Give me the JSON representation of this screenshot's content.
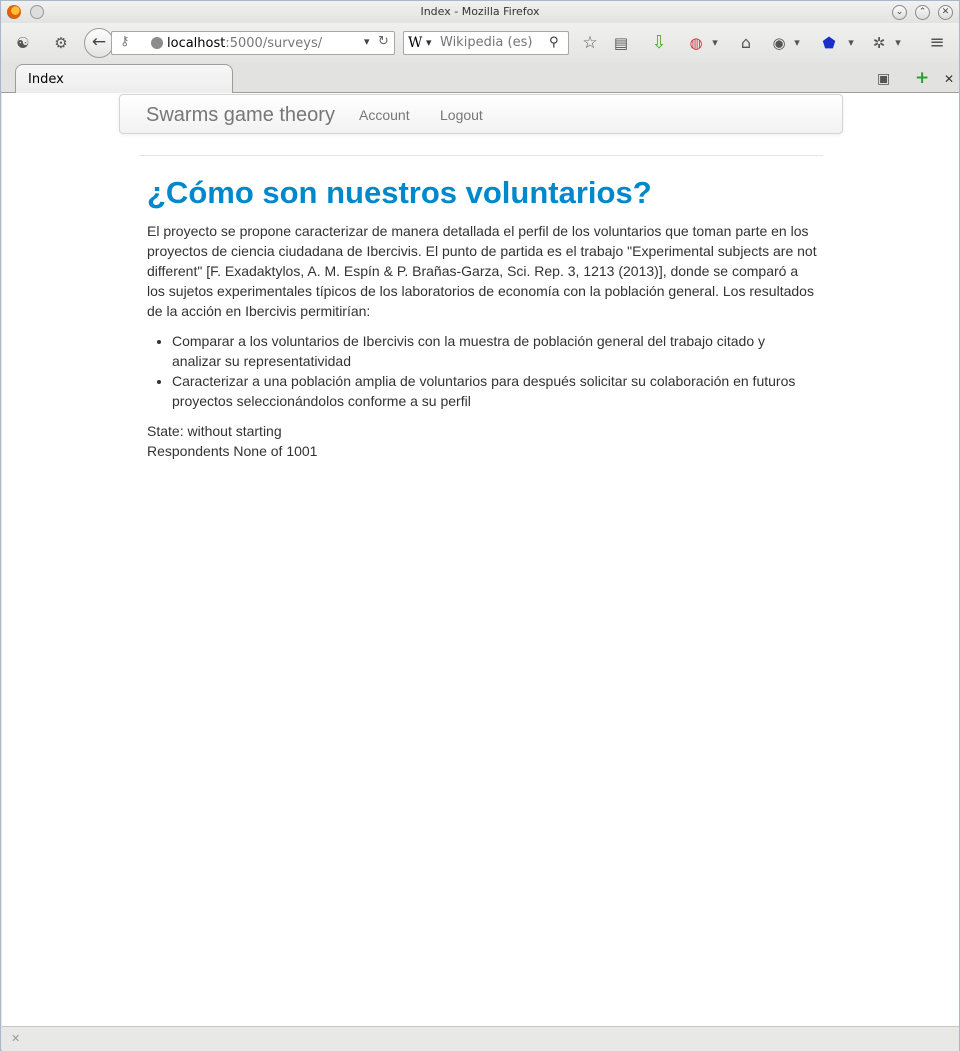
{
  "window": {
    "title": "Index - Mozilla Firefox",
    "minimize_glyph": "⌄",
    "maximize_glyph": "⌃",
    "close_glyph": "✕"
  },
  "toolbar": {
    "url_host": "localhost",
    "url_path": ":5000/surveys/",
    "search_engine_glyph": "W",
    "search_placeholder": "Wikipedia (es)"
  },
  "tabs": [
    {
      "label": "Index"
    }
  ],
  "site_nav": {
    "brand": "Swarms game theory",
    "links": [
      "Account",
      "Logout"
    ]
  },
  "main": {
    "title": "¿Cómo son nuestros voluntarios?",
    "paragraph": "El proyecto se propone caracterizar de manera detallada el perfil de los voluntarios que toman parte en los proyectos de ciencia ciudadana de Ibercivis. El punto de partida es el trabajo \"Experimental subjects are not different\" [F. Exadaktylos, A. M. Espín & P. Brañas-Garza, Sci. Rep. 3, 1213 (2013)], donde se comparó a los sujetos experimentales típicos de los laboratorios de economía con la población general. Los resultados de la acción en Ibercivis permitirían:",
    "bullets": [
      "Comparar a los voluntarios de Ibercivis con la muestra de población general del trabajo citado y analizar su representatividad",
      "Caracterizar a una población amplia de voluntarios para después solicitar su colaboración en futuros proyectos seleccionándolos conforme a su perfil"
    ],
    "state": "State: without starting",
    "respondents": "Respondents None of 1001"
  },
  "colors": {
    "heading": "#0088cc",
    "nav_text": "#777777",
    "body_text": "#333333"
  }
}
